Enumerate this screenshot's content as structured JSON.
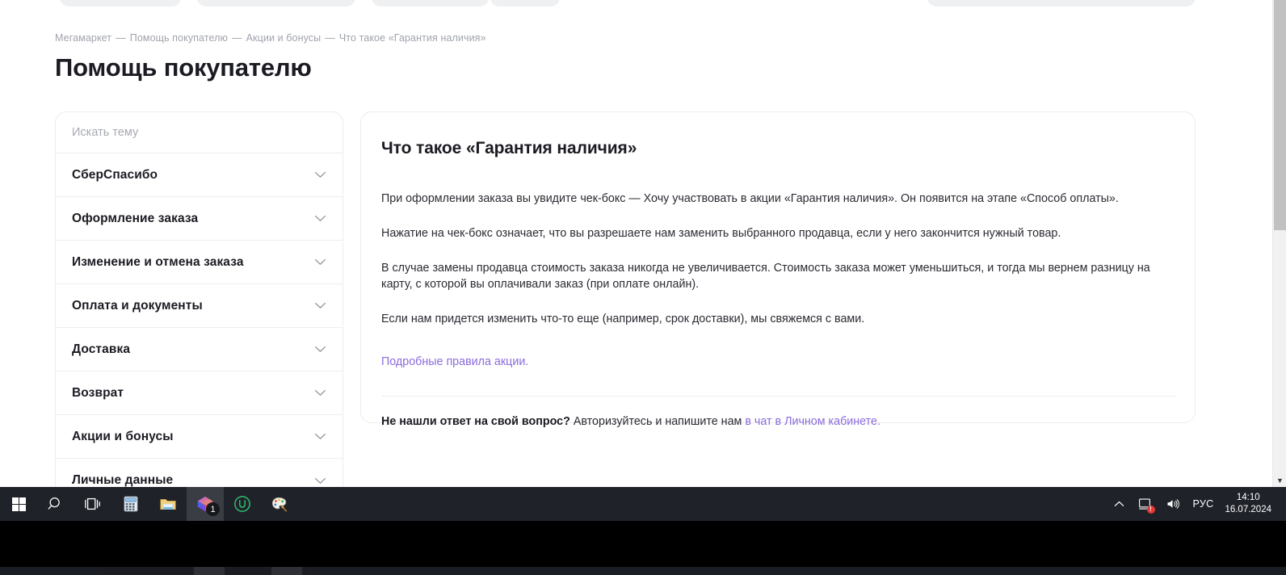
{
  "breadcrumb": {
    "items": [
      "Мегамаркет",
      "Помощь покупателю",
      "Акции и бонусы",
      "Что такое «Гарантия наличия»"
    ],
    "separator": "—"
  },
  "page": {
    "title": "Помощь покупателю"
  },
  "sidebar": {
    "search_placeholder": "Искать тему",
    "items": [
      {
        "label": "СберСпасибо",
        "icon": "chevron-down-icon"
      },
      {
        "label": "Оформление заказа",
        "icon": "chevron-down-icon"
      },
      {
        "label": "Изменение и отмена заказа",
        "icon": "chevron-down-icon"
      },
      {
        "label": "Оплата и документы",
        "icon": "chevron-down-icon"
      },
      {
        "label": "Доставка",
        "icon": "chevron-down-icon"
      },
      {
        "label": "Возврат",
        "icon": "chevron-down-icon"
      },
      {
        "label": "Акции и бонусы",
        "icon": "chevron-down-icon"
      },
      {
        "label": "Личные данные",
        "icon": "chevron-down-icon"
      }
    ]
  },
  "content": {
    "title": "Что такое «Гарантия наличия»",
    "paragraphs": [
      "При оформлении заказа вы увидите чек-бокс — Хочу участвовать в акции «Гарантия наличия». Он появится на этапе «Способ оплаты».",
      "Нажатие на чек-бокс означает, что вы разрешаете нам заменить выбранного продавца, если у него закончится нужный товар.",
      "В случае замены продавца стоимость заказа никогда не увеличивается. Стоимость заказа может уменьшиться, и тогда мы вернем разницу на карту, с которой вы оплачивали заказ (при оплате онлайн).",
      "Если нам придется изменить что-то еще (например, срок доставки), мы свяжемся с вами."
    ],
    "rules_link": "Подробные правила акции.",
    "footer": {
      "question": "Не нашли ответ на свой вопрос?",
      "text": "Авторизуйтесь и напишите нам",
      "link": "в чат в Личном кабинете."
    }
  },
  "taskbar": {
    "buttons": [
      {
        "name": "start-button",
        "icon": "windows-logo-icon"
      },
      {
        "name": "search-button",
        "icon": "search-icon"
      },
      {
        "name": "task-view-button",
        "icon": "task-view-icon"
      },
      {
        "name": "calculator-button",
        "icon": "calculator-icon"
      },
      {
        "name": "file-explorer-button",
        "icon": "folder-icon"
      },
      {
        "name": "browser-button",
        "icon": "prism-icon",
        "badge": "1"
      },
      {
        "name": "app-u-button",
        "icon": "letter-u-icon"
      },
      {
        "name": "paint-button",
        "icon": "paint-palette-icon"
      }
    ],
    "tray": {
      "overflow_icon": "chevron-up-icon",
      "network_icon": "network-alert-icon",
      "volume_icon": "speaker-icon",
      "language": "РУС",
      "time": "14:10",
      "date": "16.07.2024"
    }
  },
  "colors": {
    "link": "#8b6bdc",
    "text": "#1b1b23",
    "muted": "#a0a3ad",
    "border": "#ececee",
    "taskbar": "#1f2229"
  }
}
